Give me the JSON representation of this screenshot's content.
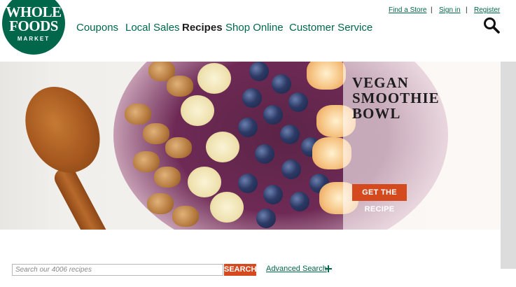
{
  "header": {
    "logo": {
      "line1": "WHOLE",
      "line2": "FOODS",
      "line3": "MARKET",
      "color": "#00674b"
    },
    "nav": [
      {
        "label": "Coupons"
      },
      {
        "label": "Local Sales"
      },
      {
        "label": "Recipes",
        "active": true
      },
      {
        "label": "Shop Online"
      },
      {
        "label": "Customer Service"
      }
    ],
    "utility": {
      "find_store": "Find a Store",
      "sign_in": "Sign in",
      "register": "Register",
      "separator": "|"
    },
    "search_icon": "search-icon"
  },
  "hero": {
    "title_line1": "VEGAN",
    "title_line2": "SMOOTHIE",
    "title_line3": "BOWL",
    "button_label": "GET THE RECIPE",
    "accent_color": "#d4491e"
  },
  "recipe_search": {
    "placeholder": "Search our 4006 recipes",
    "value": "",
    "button_label": "SEARCH",
    "advanced_label": "Advanced Search",
    "advanced_icon": "plus-icon"
  }
}
